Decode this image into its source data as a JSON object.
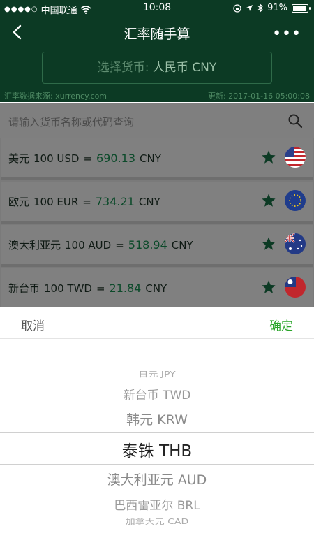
{
  "status_bar": {
    "carrier": "中国联通",
    "time": "10:08",
    "battery": "91%",
    "battery_level": 0.91
  },
  "nav": {
    "title": "汇率随手算",
    "more": "•••"
  },
  "selector": {
    "label": "选择货币:",
    "value": "人民币 CNY"
  },
  "info": {
    "source": "汇率数据来源: xurrency.com",
    "updated": "更新: 2017-01-16 05:00:08"
  },
  "search": {
    "placeholder": "请输入货币名称或代码查询"
  },
  "rates": [
    {
      "name": "美元",
      "amount": "100 USD",
      "eq": "=",
      "value": "690.13",
      "target": "CNY",
      "flag": "us-flag-icon"
    },
    {
      "name": "欧元",
      "amount": "100 EUR",
      "eq": "=",
      "value": "734.21",
      "target": "CNY",
      "flag": "eu-flag-icon"
    },
    {
      "name": "澳大利亚元",
      "amount": "100 AUD",
      "eq": "=",
      "value": "518.94",
      "target": "CNY",
      "flag": "au-flag-icon"
    },
    {
      "name": "新台币",
      "amount": "100 TWD",
      "eq": "=",
      "value": "21.84",
      "target": "CNY",
      "flag": "tw-flag-icon"
    }
  ],
  "picker": {
    "cancel": "取消",
    "confirm": "确定",
    "options": [
      "日元 JPY",
      "新台币 TWD",
      "韩元 KRW",
      "泰铢 THB",
      "澳大利亚元 AUD",
      "巴西雷亚尔 BRL",
      "加拿大元 CAD"
    ]
  },
  "colors": {
    "header_bg": "#0c3a24",
    "accent_green": "#2aa52a"
  }
}
